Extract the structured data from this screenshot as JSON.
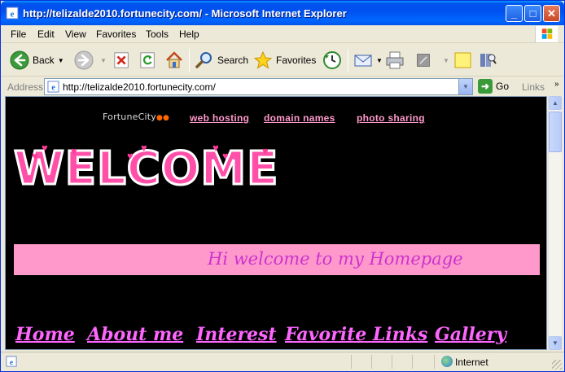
{
  "window": {
    "title": "http://telizalde2010.fortunecity.com/ - Microsoft Internet Explorer",
    "minimize": "_",
    "maximize": "□",
    "close": "✕"
  },
  "menu": {
    "items": [
      "File",
      "Edit",
      "View",
      "Favorites",
      "Tools",
      "Help"
    ]
  },
  "toolbar": {
    "back_label": "Back",
    "search_label": "Search",
    "favorites_label": "Favorites"
  },
  "address": {
    "label": "Address",
    "url": "http://telizalde2010.fortunecity.com/",
    "go_label": "Go",
    "links_label": "Links"
  },
  "page": {
    "host_logo": "FortuneCity",
    "host_links": [
      "web hosting",
      "domain names",
      "photo sharing"
    ],
    "welcome": "WELCOME",
    "banner": "Hi welcome to my Homepage",
    "nav": [
      "Home",
      "About me",
      "Interest",
      "Favorite Links",
      "Gallery"
    ]
  },
  "status": {
    "zone": "Internet"
  },
  "colors": {
    "titlebar": "#0053ee",
    "page_background": "#000000",
    "banner_background": "#ff99cc",
    "banner_text": "#cc33cc",
    "nav_text": "#ff66ff",
    "host_link": "#ff99cc"
  },
  "icons": [
    "ie-window-icon",
    "back-arrow-icon",
    "forward-arrow-icon",
    "stop-icon",
    "refresh-icon",
    "home-icon",
    "search-icon",
    "favorites-star-icon",
    "history-icon",
    "mail-icon",
    "print-icon",
    "edit-icon",
    "discuss-icon",
    "research-icon",
    "page-icon",
    "go-arrow-icon",
    "globe-icon"
  ]
}
